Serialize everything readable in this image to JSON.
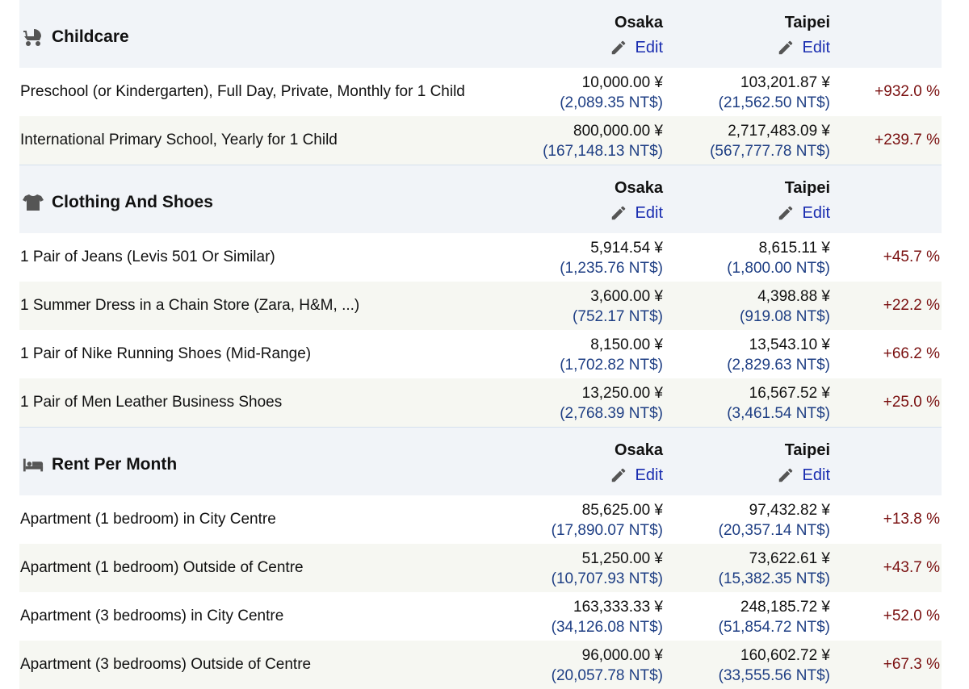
{
  "columns": {
    "city1": "Osaka",
    "city2": "Taipei",
    "edit_label": "Edit"
  },
  "icons": {
    "edit": "pencil-icon",
    "childcare": "baby-carriage-icon",
    "clothing": "t-shirt-icon",
    "rent": "bed-icon"
  },
  "colors": {
    "header_bg": "#f1f4f8",
    "alt_row_bg": "#f6f7f2",
    "link": "#1a2db0",
    "ntd": "#1f3f84",
    "pct": "#7a1010"
  },
  "sections": [
    {
      "title": "Childcare",
      "rows": [
        {
          "name": "Preschool (or Kindergarten), Full Day, Private, Monthly for 1 Child",
          "c1_yen": "10,000.00 ¥",
          "c1_ntd": "(2,089.35 NT$)",
          "c2_yen": "103,201.87 ¥",
          "c2_ntd": "(21,562.50 NT$)",
          "pct": "+932.0 %"
        },
        {
          "name": "International Primary School, Yearly for 1 Child",
          "c1_yen": "800,000.00 ¥",
          "c1_ntd": "(167,148.13 NT$)",
          "c2_yen": "2,717,483.09 ¥",
          "c2_ntd": "(567,777.78 NT$)",
          "pct": "+239.7 %"
        }
      ]
    },
    {
      "title": "Clothing And Shoes",
      "rows": [
        {
          "name": "1 Pair of Jeans (Levis 501 Or Similar)",
          "c1_yen": "5,914.54 ¥",
          "c1_ntd": "(1,235.76 NT$)",
          "c2_yen": "8,615.11 ¥",
          "c2_ntd": "(1,800.00 NT$)",
          "pct": "+45.7 %"
        },
        {
          "name": "1 Summer Dress in a Chain Store (Zara, H&M, ...)",
          "c1_yen": "3,600.00 ¥",
          "c1_ntd": "(752.17 NT$)",
          "c2_yen": "4,398.88 ¥",
          "c2_ntd": "(919.08 NT$)",
          "pct": "+22.2 %"
        },
        {
          "name": "1 Pair of Nike Running Shoes (Mid-Range)",
          "c1_yen": "8,150.00 ¥",
          "c1_ntd": "(1,702.82 NT$)",
          "c2_yen": "13,543.10 ¥",
          "c2_ntd": "(2,829.63 NT$)",
          "pct": "+66.2 %"
        },
        {
          "name": "1 Pair of Men Leather Business Shoes",
          "c1_yen": "13,250.00 ¥",
          "c1_ntd": "(2,768.39 NT$)",
          "c2_yen": "16,567.52 ¥",
          "c2_ntd": "(3,461.54 NT$)",
          "pct": "+25.0 %"
        }
      ]
    },
    {
      "title": "Rent Per Month",
      "rows": [
        {
          "name": "Apartment (1 bedroom) in City Centre",
          "c1_yen": "85,625.00 ¥",
          "c1_ntd": "(17,890.07 NT$)",
          "c2_yen": "97,432.82 ¥",
          "c2_ntd": "(20,357.14 NT$)",
          "pct": "+13.8 %"
        },
        {
          "name": "Apartment (1 bedroom) Outside of Centre",
          "c1_yen": "51,250.00 ¥",
          "c1_ntd": "(10,707.93 NT$)",
          "c2_yen": "73,622.61 ¥",
          "c2_ntd": "(15,382.35 NT$)",
          "pct": "+43.7 %"
        },
        {
          "name": "Apartment (3 bedrooms) in City Centre",
          "c1_yen": "163,333.33 ¥",
          "c1_ntd": "(34,126.08 NT$)",
          "c2_yen": "248,185.72 ¥",
          "c2_ntd": "(51,854.72 NT$)",
          "pct": "+52.0 %"
        },
        {
          "name": "Apartment (3 bedrooms) Outside of Centre",
          "c1_yen": "96,000.00 ¥",
          "c1_ntd": "(20,057.78 NT$)",
          "c2_yen": "160,602.72 ¥",
          "c2_ntd": "(33,555.56 NT$)",
          "pct": "+67.3 %"
        }
      ]
    }
  ]
}
